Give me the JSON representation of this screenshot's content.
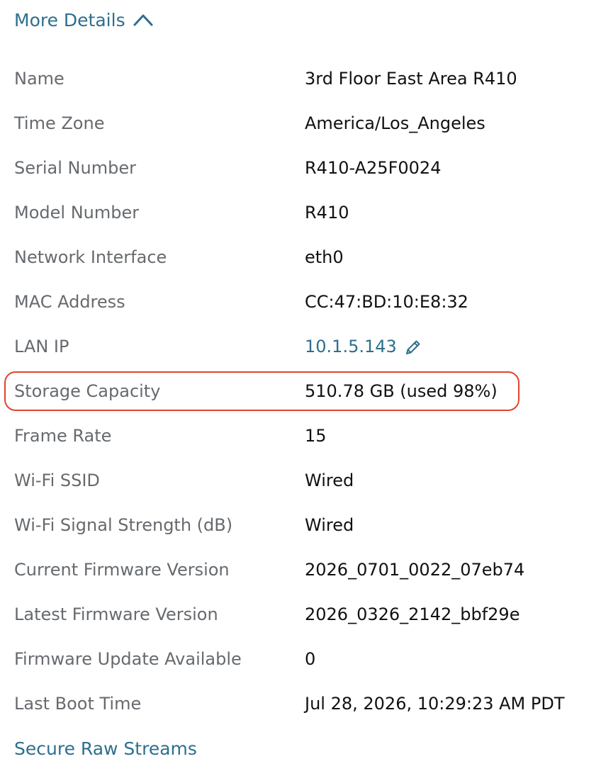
{
  "toggle": {
    "label": "More Details",
    "icon": "chevron-up-icon"
  },
  "details": {
    "rows": [
      {
        "label": "Name",
        "value": "3rd Floor East Area R410"
      },
      {
        "label": "Time Zone",
        "value": "America/Los_Angeles"
      },
      {
        "label": "Serial Number",
        "value": "R410-A25F0024"
      },
      {
        "label": "Model Number",
        "value": "R410"
      },
      {
        "label": "Network Interface",
        "value": "eth0"
      },
      {
        "label": "MAC Address",
        "value": "CC:47:BD:10:E8:32"
      },
      {
        "label": "LAN IP",
        "value": "10.1.5.143",
        "icon": "pencil-icon"
      },
      {
        "label": "Storage Capacity",
        "value": "510.78 GB (used 98%)"
      },
      {
        "label": "Frame Rate",
        "value": "15"
      },
      {
        "label": "Wi-Fi SSID",
        "value": "Wired"
      },
      {
        "label": "Wi-Fi Signal Strength (dB)",
        "value": "Wired"
      },
      {
        "label": "Current Firmware Version",
        "value": "2026_0701_0022_07eb74"
      },
      {
        "label": "Latest Firmware Version",
        "value": "2026_0326_2142_bbf29e"
      },
      {
        "label": "Firmware Update Available",
        "value": "0"
      },
      {
        "label": "Last Boot Time",
        "value": "Jul 28, 2026, 10:29:23 AM PDT"
      }
    ]
  },
  "footer": {
    "link_label": "Secure Raw Streams"
  },
  "colors": {
    "link": "#2e6f8e",
    "label": "#666a6e",
    "value": "#111111",
    "highlight": "#e0452c"
  }
}
